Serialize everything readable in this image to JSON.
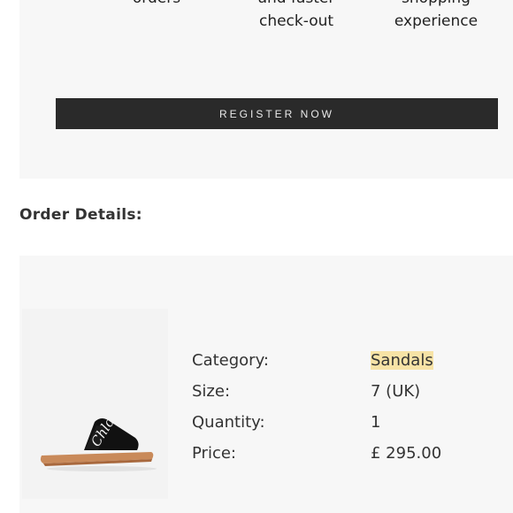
{
  "benefits": [
    {
      "line1": "orders",
      "line2": ""
    },
    {
      "line1": "and faster",
      "line2": "check-out"
    },
    {
      "line1": "shopping",
      "line2": "experience"
    }
  ],
  "register_button": "REGISTER NOW",
  "order_details": {
    "title": "Order Details:",
    "product_image_icon": "chloe-woody-slide-sandal",
    "rows": [
      {
        "label": "Category:",
        "value": "Sandals",
        "highlighted": true
      },
      {
        "label": "Size:",
        "value": "7 (UK)"
      },
      {
        "label": "Quantity:",
        "value": "1"
      },
      {
        "label": "Price:",
        "value": "£ 295.00"
      }
    ]
  },
  "colors": {
    "button_bg": "#2a2a2a",
    "panel_bg": "#f7f7f7",
    "highlight": "#f7e3a6"
  }
}
